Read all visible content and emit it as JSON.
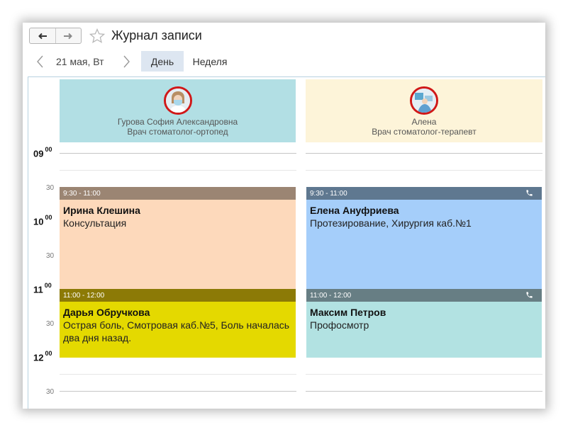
{
  "window": {
    "title": "Журнал записи",
    "back_icon": "arrow-left-icon",
    "forward_icon": "arrow-right-icon",
    "favorite_icon": "star-outline-icon"
  },
  "date_nav": {
    "date": "21 мая, Вт",
    "prev_icon": "chevron-left-icon",
    "next_icon": "chevron-right-icon",
    "views": [
      {
        "label": "День",
        "active": true
      },
      {
        "label": "Неделя",
        "active": false
      }
    ]
  },
  "doctors": [
    {
      "name": "Гурова София Александровна",
      "specialty": "Врач стоматолог-ортопед",
      "card_color": "#b2dfe4"
    },
    {
      "name": "Алена",
      "specialty": "Врач стоматолог-терапевт",
      "card_color": "#fdf4d9"
    }
  ],
  "time_labels": [
    {
      "text": "09",
      "sup": "00",
      "kind": "hour"
    },
    {
      "text": "30",
      "kind": "half"
    },
    {
      "text": "10",
      "sup": "00",
      "kind": "hour"
    },
    {
      "text": "30",
      "kind": "half"
    },
    {
      "text": "11",
      "sup": "00",
      "kind": "hour"
    },
    {
      "text": "30",
      "kind": "half"
    },
    {
      "text": "12",
      "sup": "00",
      "kind": "hour"
    },
    {
      "text": "30",
      "kind": "half"
    }
  ],
  "appointments": [
    {
      "time": "9:30 - 11:00",
      "patient": "Ирина Клешина",
      "description": "Консультация",
      "header_color": "#9b8573",
      "body_color": "#fdd9bb",
      "phone": false
    },
    {
      "time": "9:30 - 11:00",
      "patient": "Елена Ануфриева",
      "description": "Протезирование, Хирургия каб.№1",
      "header_color": "#5f7890",
      "body_color": "#a5cefa",
      "phone": true,
      "phone_icon": "phone-icon"
    },
    {
      "time": "11:00 - 12:00",
      "patient": "Дарья Обручкова",
      "description": "Острая боль, Смотровая каб.№5, Боль началась два дня назад.",
      "header_color": "#8c7a06",
      "body_color": "#e4d900",
      "phone": false
    },
    {
      "time": "11:00 - 12:00",
      "patient": "Максим Петров",
      "description": "Профосмотр",
      "header_color": "#677e84",
      "body_color": "#b2e2e2",
      "phone": true,
      "phone_icon": "phone-icon"
    }
  ]
}
